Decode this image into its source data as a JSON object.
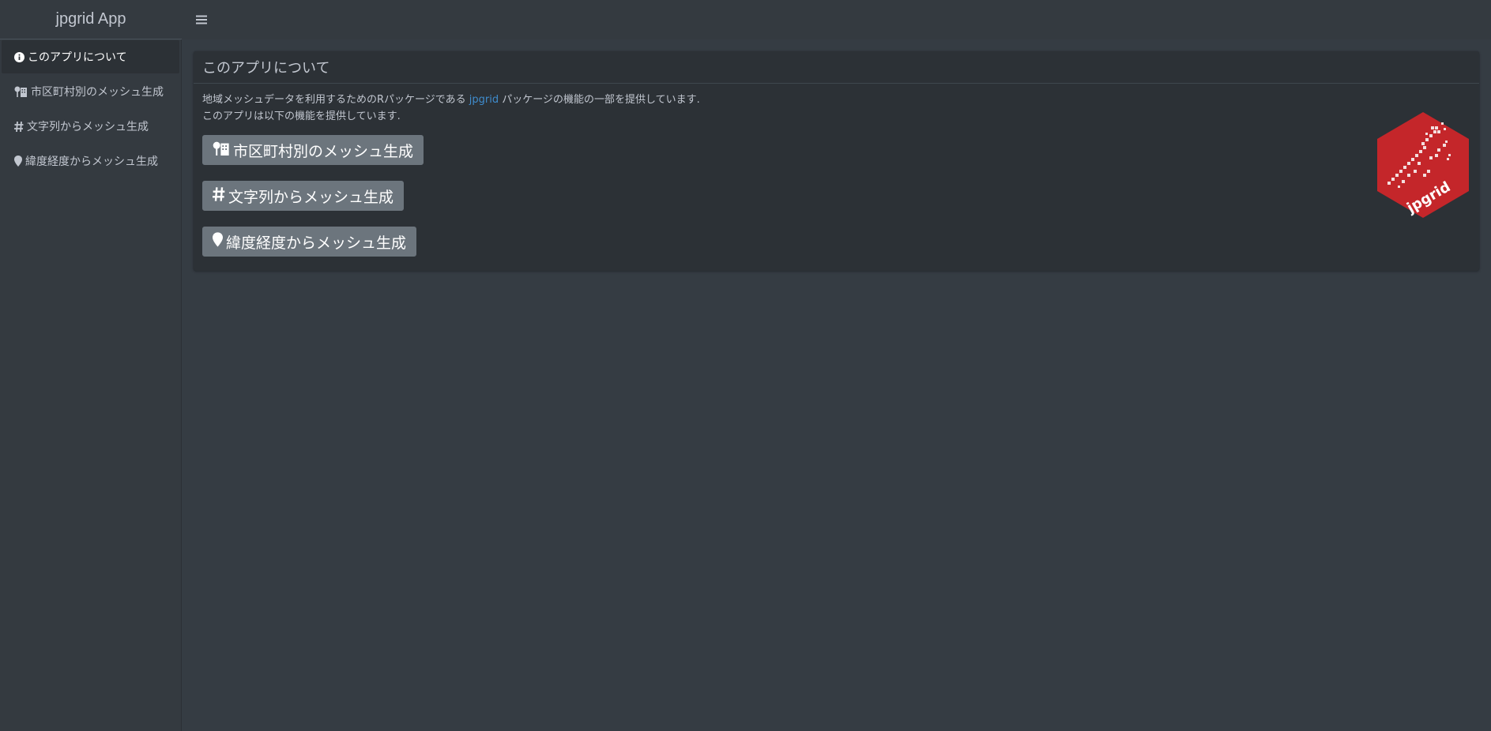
{
  "app": {
    "brand": "jpgrid App",
    "menu_icon": "bars-icon"
  },
  "sidebar": {
    "items": [
      {
        "label": "このアプリについて",
        "icon": "info-circle-icon",
        "active": true
      },
      {
        "label": "市区町村別のメッシュ生成",
        "icon": "map-signs-icon",
        "active": false
      },
      {
        "label": "文字列からメッシュ生成",
        "icon": "hashtag-icon",
        "active": false
      },
      {
        "label": "緯度経度からメッシュ生成",
        "icon": "map-marker-icon",
        "active": false
      }
    ]
  },
  "card": {
    "title": "このアプリについて",
    "line1_pre": "地域メッシュデータを利用するためのRパッケージである",
    "line1_link": "jpgrid",
    "line1_post": "パッケージの機能の一部を提供しています.",
    "line2": "このアプリは以下の機能を提供しています.",
    "buttons": [
      {
        "label": "市区町村別のメッシュ生成",
        "icon": "map-signs-icon"
      },
      {
        "label": "文字列からメッシュ生成",
        "icon": "hashtag-icon"
      },
      {
        "label": "緯度経度からメッシュ生成",
        "icon": "map-marker-icon"
      }
    ],
    "logo_text": "jpgrid"
  },
  "colors": {
    "sidebar_bg": "#343a40",
    "content_bg": "#353c43",
    "card_bg": "#2c3136",
    "button_bg": "#6c757d",
    "link": "#3f8ccd",
    "logo_red": "#c4262a"
  }
}
